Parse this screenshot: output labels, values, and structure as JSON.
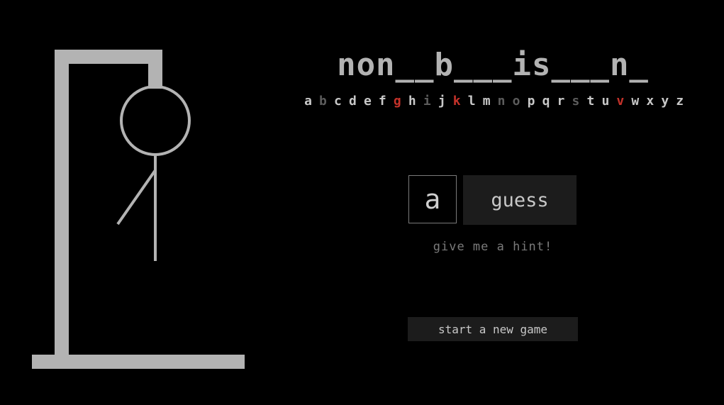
{
  "game": {
    "masked_word": "non__b___is___n_",
    "guess_value": "a",
    "guess_label": "guess",
    "hint_label": "give me a hint!",
    "new_game_label": "start a new game",
    "wrong_guesses": 3
  },
  "alphabet": [
    {
      "letter": "a",
      "state": "available"
    },
    {
      "letter": "b",
      "state": "used"
    },
    {
      "letter": "c",
      "state": "available"
    },
    {
      "letter": "d",
      "state": "available"
    },
    {
      "letter": "e",
      "state": "available"
    },
    {
      "letter": "f",
      "state": "available"
    },
    {
      "letter": "g",
      "state": "wrong"
    },
    {
      "letter": "h",
      "state": "available"
    },
    {
      "letter": "i",
      "state": "used"
    },
    {
      "letter": "j",
      "state": "available"
    },
    {
      "letter": "k",
      "state": "wrong"
    },
    {
      "letter": "l",
      "state": "available"
    },
    {
      "letter": "m",
      "state": "available"
    },
    {
      "letter": "n",
      "state": "used"
    },
    {
      "letter": "o",
      "state": "used"
    },
    {
      "letter": "p",
      "state": "available"
    },
    {
      "letter": "q",
      "state": "available"
    },
    {
      "letter": "r",
      "state": "available"
    },
    {
      "letter": "s",
      "state": "used"
    },
    {
      "letter": "t",
      "state": "available"
    },
    {
      "letter": "u",
      "state": "available"
    },
    {
      "letter": "v",
      "state": "wrong"
    },
    {
      "letter": "w",
      "state": "available"
    },
    {
      "letter": "x",
      "state": "available"
    },
    {
      "letter": "y",
      "state": "available"
    },
    {
      "letter": "z",
      "state": "available"
    }
  ],
  "colors": {
    "background": "#000000",
    "gallows": "#b3b3b3",
    "wrong_letter": "#c4322a",
    "used_letter": "#5c5c5c",
    "available_letter": "#c8c8c8"
  }
}
